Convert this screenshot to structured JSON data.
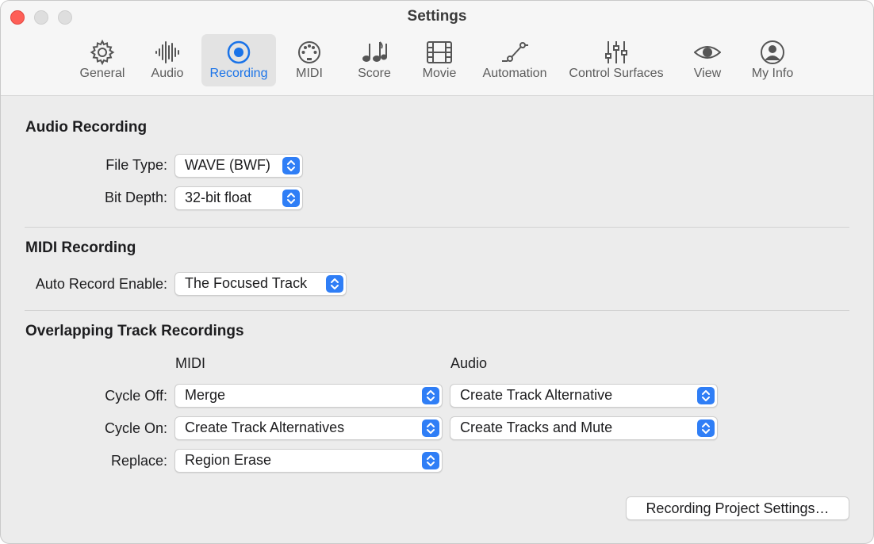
{
  "window": {
    "title": "Settings"
  },
  "toolbar": {
    "tabs": [
      {
        "label": "General",
        "icon": "gear-icon"
      },
      {
        "label": "Audio",
        "icon": "waveform-icon"
      },
      {
        "label": "Recording",
        "icon": "record-icon",
        "selected": true
      },
      {
        "label": "MIDI",
        "icon": "midi-port-icon"
      },
      {
        "label": "Score",
        "icon": "music-notes-icon"
      },
      {
        "label": "Movie",
        "icon": "film-icon"
      },
      {
        "label": "Automation",
        "icon": "automation-curve-icon"
      },
      {
        "label": "Control Surfaces",
        "icon": "sliders-icon"
      },
      {
        "label": "View",
        "icon": "eye-icon"
      },
      {
        "label": "My Info",
        "icon": "person-icon"
      }
    ]
  },
  "audio_recording": {
    "title": "Audio Recording",
    "file_type": {
      "label": "File Type:",
      "value": "WAVE (BWF)"
    },
    "bit_depth": {
      "label": "Bit Depth:",
      "value": "32-bit float"
    }
  },
  "midi_recording": {
    "title": "MIDI Recording",
    "auto_record": {
      "label": "Auto Record Enable:",
      "value": "The Focused Track"
    }
  },
  "overlapping": {
    "title": "Overlapping Track Recordings",
    "col_midi": "MIDI",
    "col_audio": "Audio",
    "cycle_off": {
      "label": "Cycle Off:",
      "midi": "Merge",
      "audio": "Create Track Alternative"
    },
    "cycle_on": {
      "label": "Cycle On:",
      "midi": "Create Track Alternatives",
      "audio": "Create Tracks and Mute"
    },
    "replace": {
      "label": "Replace:",
      "midi": "Region Erase"
    }
  },
  "project_button": "Recording Project Settings…",
  "colors": {
    "accent": "#2f7ef6",
    "close": "#fe5f57"
  }
}
